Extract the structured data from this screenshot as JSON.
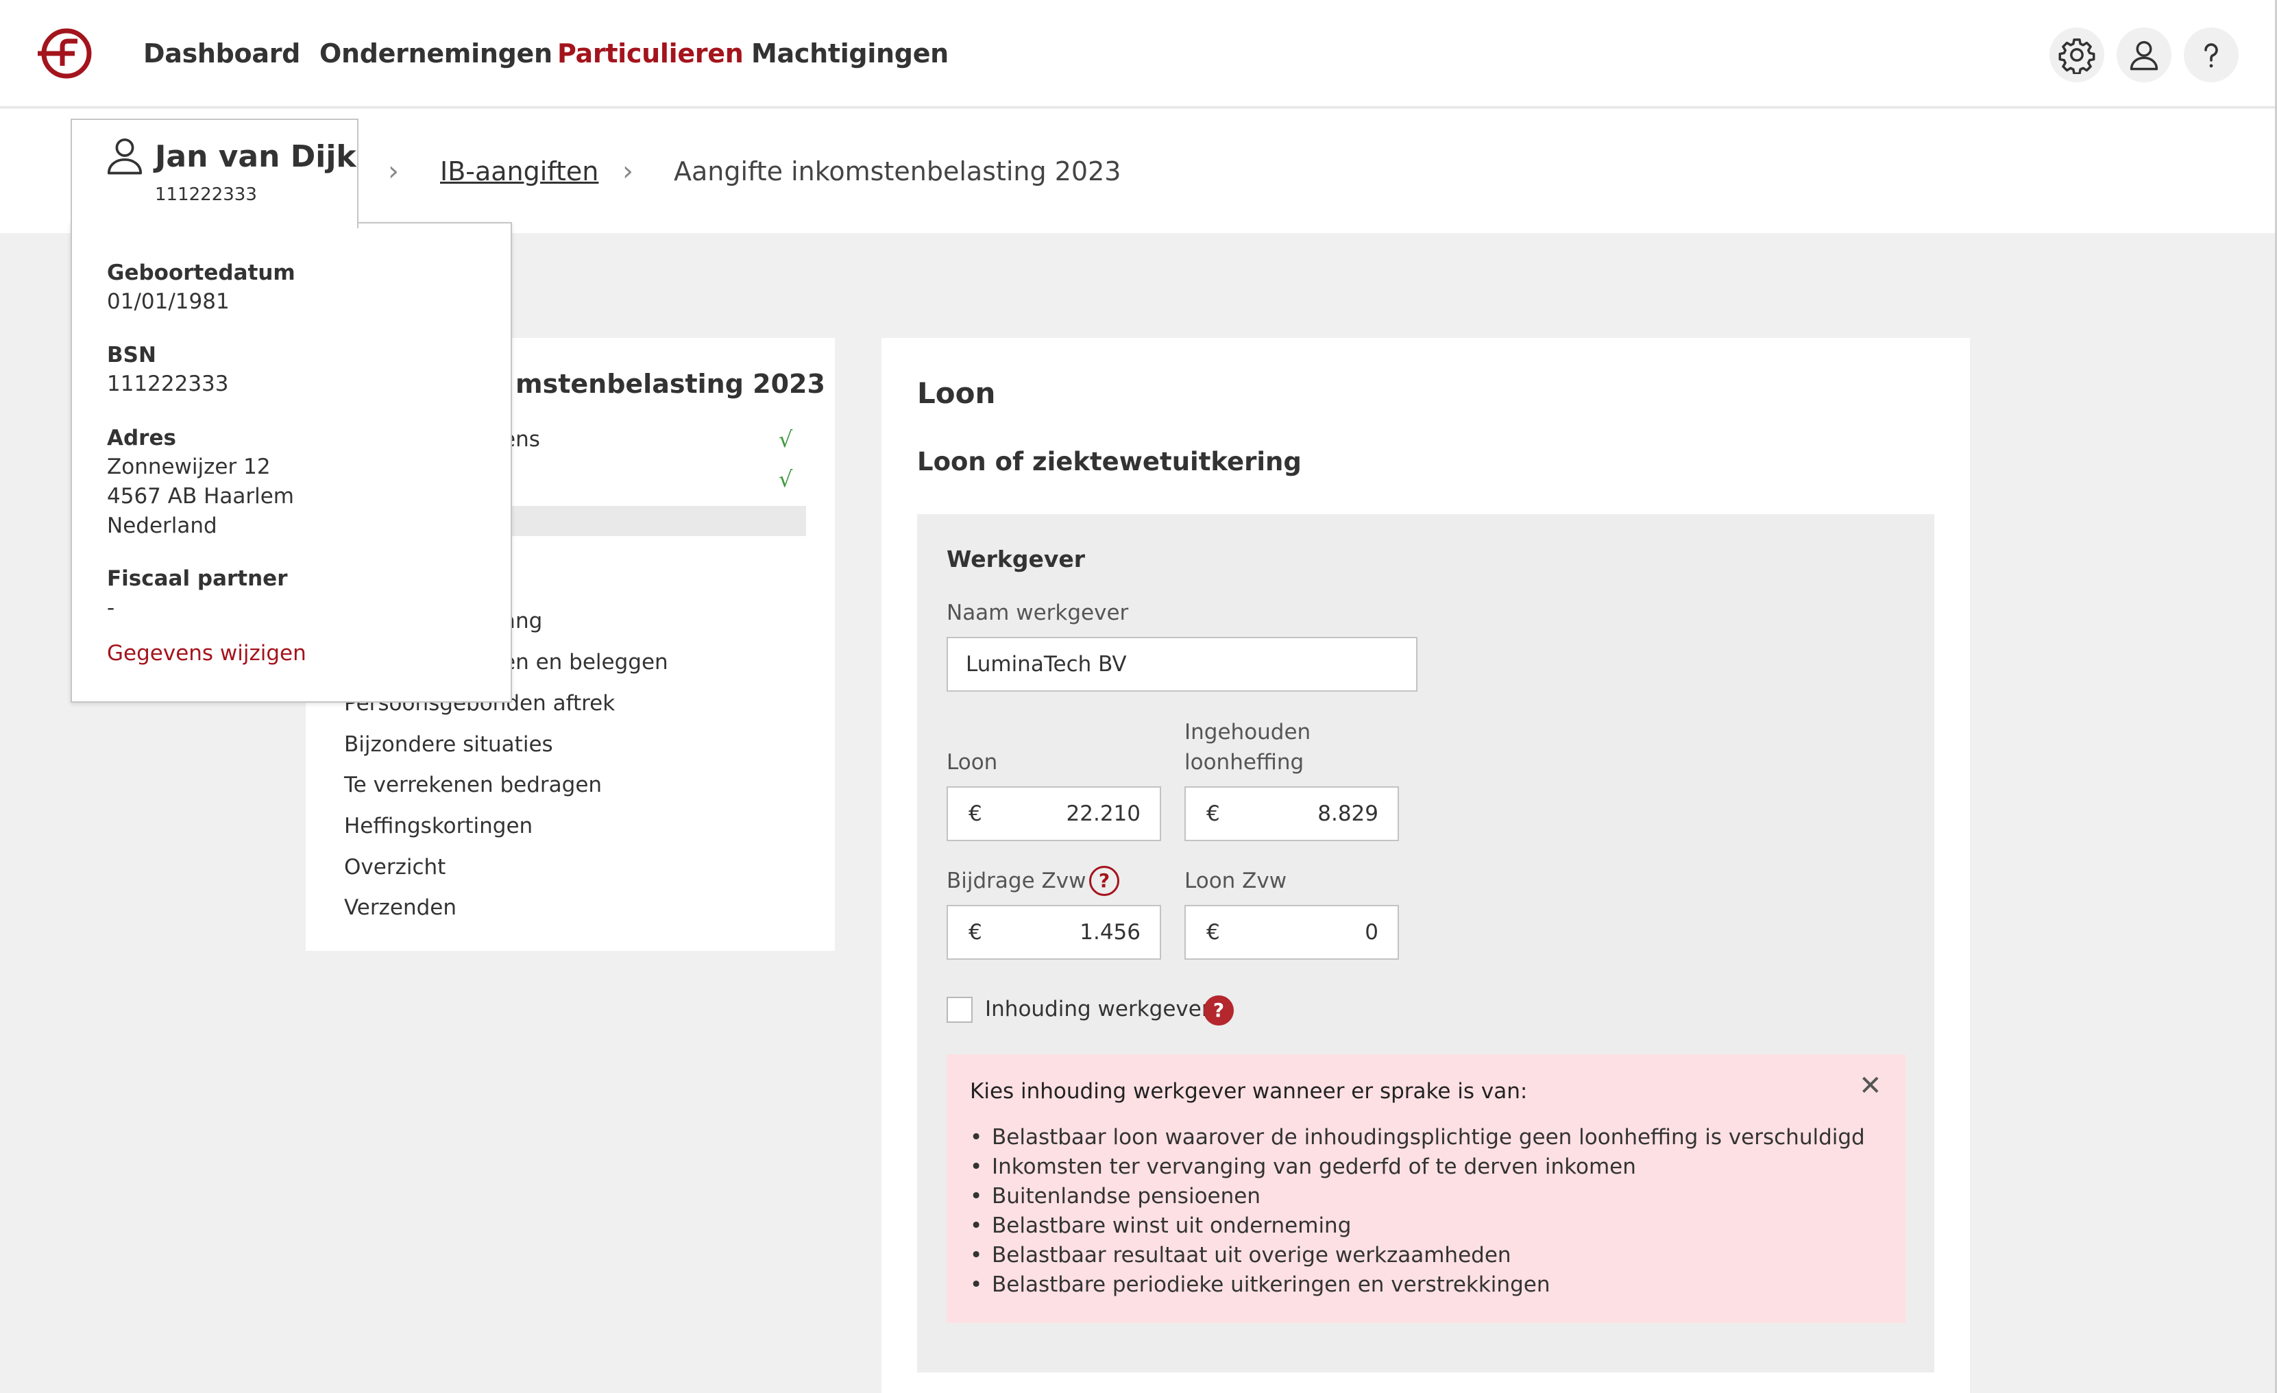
{
  "colors": {
    "brand": "#a4141c",
    "check": "#3c9a3c",
    "info_bg": "#fde0e3"
  },
  "header": {
    "logo_icon": "brand-logo-icon",
    "nav": [
      "Dashboard",
      "Ondernemingen",
      "Particulieren",
      "Machtigingen"
    ],
    "active_nav": "Particulieren",
    "icons": [
      "gear-icon",
      "user-icon",
      "help-icon"
    ]
  },
  "breadcrumb": {
    "link": "IB-aangiften",
    "current": "Aangifte inkomstenbelasting 2023"
  },
  "person": {
    "name": "Jan van Dijk",
    "id": "111222333",
    "birth_label": "Geboortedatum",
    "birth_value": "01/01/1981",
    "bsn_label": "BSN",
    "bsn_value": "111222333",
    "address_label": "Adres",
    "address_lines": [
      "Zonnewijzer 12",
      "4567 AB Haarlem",
      "Nederland"
    ],
    "partner_label": "Fiscaal partner",
    "partner_value": "-",
    "edit_link": "Gegevens wijzigen"
  },
  "steps": {
    "title_visible": "mstenbelasting 2023",
    "items": [
      {
        "label": "ens",
        "done": true
      },
      {
        "label": "",
        "done": true
      },
      {
        "label": "ang",
        "done": false
      },
      {
        "label": "en en beleggen",
        "done": false
      },
      {
        "label": "Persoonsgebonden aftrek",
        "done": false
      },
      {
        "label": "Bijzondere situaties",
        "done": false
      },
      {
        "label": "Te verrekenen bedragen",
        "done": false
      },
      {
        "label": "Heffingskortingen",
        "done": false
      },
      {
        "label": "Overzicht",
        "done": false
      },
      {
        "label": "Verzenden",
        "done": false
      }
    ],
    "check_symbol": "√"
  },
  "form": {
    "title": "Loon",
    "subtitle": "Loon of ziektewetuitkering",
    "panel_title": "Werkgever",
    "employer_label": "Naam werkgever",
    "employer_value": "LuminaTech BV",
    "currency": "€",
    "loon_label": "Loon",
    "loon_value": "22.210",
    "withheld_label_1": "Ingehouden",
    "withheld_label_2": "loonheffing",
    "withheld_value": "8.829",
    "zvw_label": "Bijdrage Zvw",
    "zvw_value": "1.456",
    "loon_zvw_label": "Loon Zvw",
    "loon_zvw_value": "0",
    "checkbox_label": "Inhouding werkgever",
    "checkbox_checked": false,
    "help_symbol": "?"
  },
  "info": {
    "title": "Kies inhouding werkgever wanneer er sprake is van:",
    "close_symbol": "✕",
    "items": [
      "Belastbaar loon waarover de inhoudingsplichtige geen loonheffing is verschuldigd",
      "Inkomsten ter vervanging van gederfd of te derven inkomen",
      "Buitenlandse pensioenen",
      "Belastbare winst uit onderneming",
      "Belastbaar resultaat uit overige werkzaamheden",
      "Belastbare periodieke uitkeringen en verstrekkingen"
    ]
  }
}
